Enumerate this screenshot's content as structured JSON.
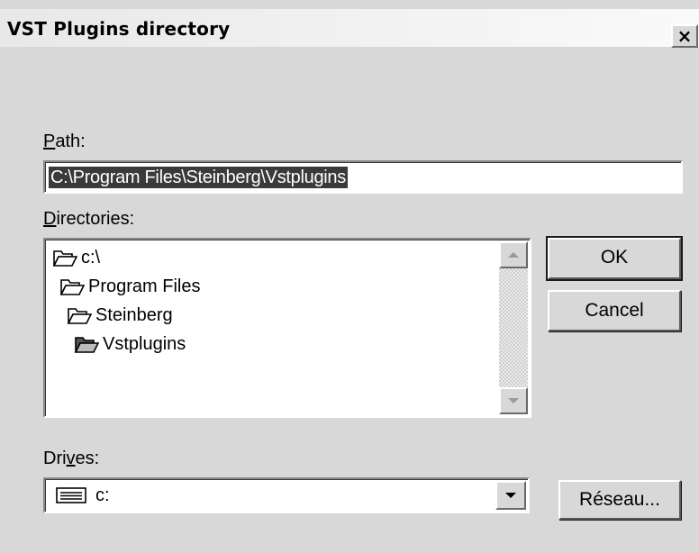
{
  "window": {
    "title": "VST Plugins directory",
    "close_glyph": "×"
  },
  "path": {
    "label_accel": "P",
    "label_rest": "ath:",
    "value": "C:\\Program Files\\Steinberg\\Vstplugins"
  },
  "directories": {
    "label_accel": "D",
    "label_rest": "irectories:",
    "items": [
      {
        "label": "c:\\",
        "icon": "open-folder-icon",
        "depth": 0
      },
      {
        "label": "Program Files",
        "icon": "open-folder-icon",
        "depth": 1
      },
      {
        "label": "Steinberg",
        "icon": "open-folder-icon",
        "depth": 2
      },
      {
        "label": "Vstplugins",
        "icon": "open-folder-icon",
        "depth": 3,
        "selected": true
      }
    ]
  },
  "drives": {
    "label_pre": "Dri",
    "label_accel": "v",
    "label_rest": "es:",
    "selected": "c:",
    "icon": "hard-drive-icon"
  },
  "buttons": {
    "ok": "OK",
    "cancel": "Cancel",
    "network": "Réseau..."
  },
  "colors": {
    "dialog_bg": "#d8d8d8",
    "selection_bg": "#3a3a3a",
    "field_bg": "#ffffff"
  }
}
